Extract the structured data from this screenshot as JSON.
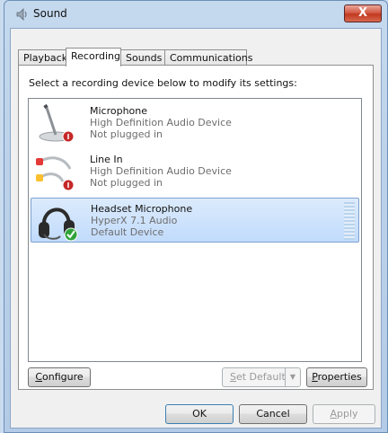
{
  "window": {
    "title": "Sound",
    "close_label": "X"
  },
  "tabs": [
    {
      "label": "Playback"
    },
    {
      "label": "Recording"
    },
    {
      "label": "Sounds"
    },
    {
      "label": "Communications"
    }
  ],
  "instruction": "Select a recording device below to modify its settings:",
  "devices": [
    {
      "name": "Microphone",
      "description": "High Definition Audio Device",
      "status": "Not plugged in"
    },
    {
      "name": "Line In",
      "description": "High Definition Audio Device",
      "status": "Not plugged in"
    },
    {
      "name": "Headset Microphone",
      "description": "HyperX 7.1 Audio",
      "status": "Default Device"
    }
  ],
  "buttons": {
    "configure_first": "C",
    "configure_rest": "onfigure",
    "set_default_first": "S",
    "set_default_rest": "et Default",
    "properties_first": "P",
    "properties_rest": "roperties",
    "ok": "OK",
    "cancel": "Cancel",
    "apply_first": "A",
    "apply_rest": "pply"
  },
  "colors": {
    "selection": "#c1dbfc",
    "window_frame": "#bcd2ea",
    "close_red": "#c0381f",
    "status_ok": "#2fa33a",
    "unplugged_red": "#c62828"
  }
}
